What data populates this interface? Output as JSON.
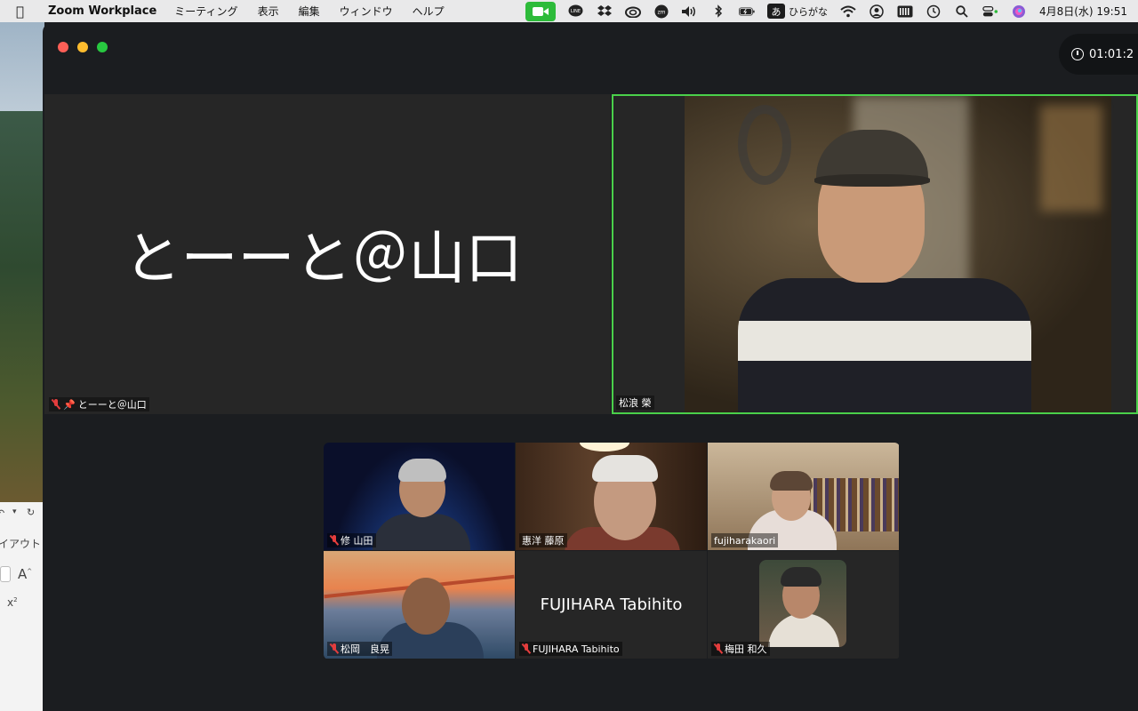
{
  "menubar": {
    "app_name": "Zoom Workplace",
    "menus": [
      "ミーティング",
      "表示",
      "編集",
      "ウィンドウ",
      "ヘルプ"
    ],
    "ime_badge": "あ",
    "ime_label": "ひらがな",
    "datetime": "4月8日(水)  19:51"
  },
  "desktop": {
    "doc_text": "イアウト"
  },
  "meeting": {
    "timer": "01:01:2",
    "big_tiles": [
      {
        "display_name": "とーーと＠山口",
        "label": "とーーと＠山口",
        "muted": true,
        "pinned": true
      },
      {
        "label": "松浪 榮",
        "muted": false,
        "active_speaker": true
      }
    ],
    "gallery": [
      {
        "label": "修 山田",
        "muted": true
      },
      {
        "label": "惠洋 藤原",
        "muted": false
      },
      {
        "label": "fujiharakaori",
        "muted": false
      },
      {
        "label": "松岡　良晃",
        "muted": true
      },
      {
        "display_name": "FUJIHARA Tabihito",
        "label": "FUJIHARA Tabihito",
        "muted": true
      },
      {
        "label": "梅田 和久",
        "muted": true
      }
    ]
  },
  "colors": {
    "active_speaker_border": "#4ad04a",
    "muted_icon": "#e43d3d",
    "window_bg": "#1b1d20",
    "tile_bg": "#262626"
  }
}
